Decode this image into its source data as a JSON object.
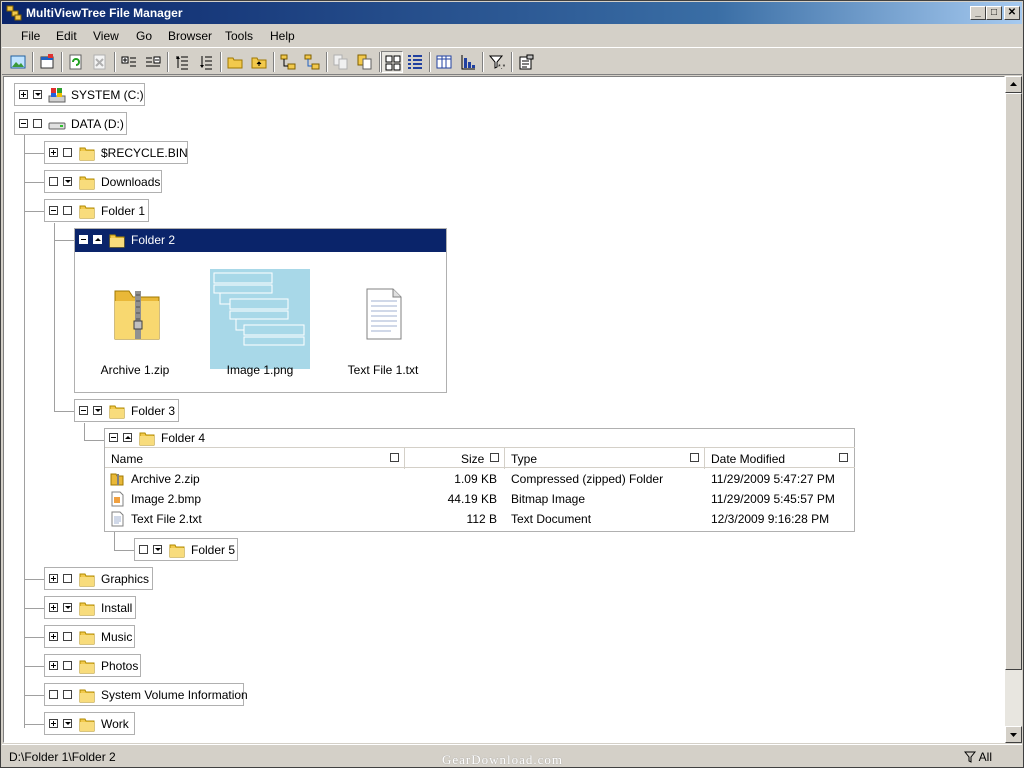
{
  "window": {
    "title": "MultiViewTree File Manager"
  },
  "menu": [
    {
      "label": "File"
    },
    {
      "label": "Edit"
    },
    {
      "label": "View"
    },
    {
      "label": "Go"
    },
    {
      "label": "Browser"
    },
    {
      "label": "Tools"
    },
    {
      "label": "Help"
    }
  ],
  "toolbar": {
    "icons": [
      "image-view-icon",
      "new-window-icon",
      "refresh-icon",
      "delete-icon",
      "expand-all-icon",
      "collapse-all-icon",
      "list-expand-icon",
      "list-collapse-icon",
      "new-folder-icon",
      "folder-up-icon",
      "copy-tree-icon",
      "move-tree-icon",
      "copy-disabled-icon",
      "paste-icon",
      "thumbnail-view-icon",
      "details-view-icon",
      "columns-icon",
      "sort-icon",
      "filter-icon",
      "properties-icon"
    ]
  },
  "tree": {
    "system": "SYSTEM (C:)",
    "data": "DATA (D:)",
    "recycle": "$RECYCLE.BIN",
    "downloads": "Downloads",
    "folder1": "Folder 1",
    "folder2": "Folder 2",
    "folder3": "Folder 3",
    "folder4": "Folder 4",
    "folder5": "Folder 5",
    "graphics": "Graphics",
    "install": "Install",
    "music": "Music",
    "photos": "Photos",
    "sysvol": "System Volume Information",
    "work": "Work"
  },
  "folder2_items": [
    {
      "name": "Archive 1.zip"
    },
    {
      "name": "Image 1.png"
    },
    {
      "name": "Text File 1.txt"
    }
  ],
  "details": {
    "columns": [
      "Name",
      "Size",
      "Type",
      "Date Modified"
    ],
    "rows": [
      {
        "name": "Archive 2.zip",
        "size": "1.09 KB",
        "type": "Compressed (zipped) Folder",
        "date": "11/29/2009 5:47:27 PM"
      },
      {
        "name": "Image 2.bmp",
        "size": "44.19 KB",
        "type": "Bitmap Image",
        "date": "11/29/2009 5:45:57 PM"
      },
      {
        "name": "Text File 2.txt",
        "size": "112 B",
        "type": "Text Document",
        "date": "12/3/2009 9:16:28 PM"
      }
    ]
  },
  "status": {
    "path": "D:\\Folder 1\\Folder 2",
    "watermark": "GearDownload.com",
    "filter": "All"
  },
  "colors": {
    "selection": "#0a246a",
    "folder": "#f2c94c",
    "image_bg": "#a8d8e8"
  }
}
